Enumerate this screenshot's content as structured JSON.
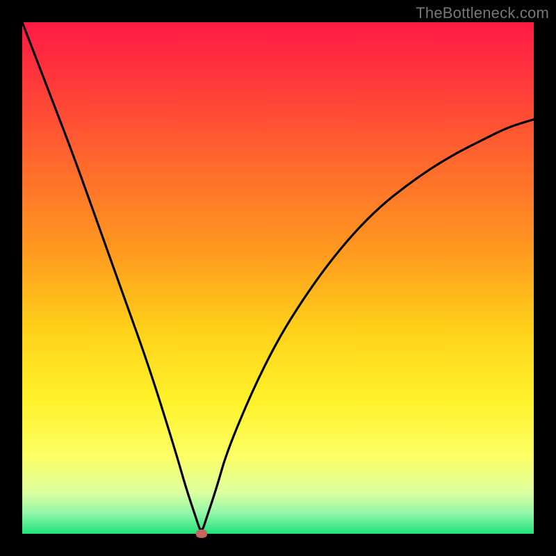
{
  "watermark": {
    "text": "TheBottleneck.com"
  },
  "colors": {
    "page_bg": "#000000",
    "curve": "#000000",
    "marker": "#c66660",
    "gradient_stops": [
      {
        "pct": 0,
        "color": "#ff1a44"
      },
      {
        "pct": 12,
        "color": "#ff3a3a"
      },
      {
        "pct": 28,
        "color": "#ff6a2d"
      },
      {
        "pct": 45,
        "color": "#ff9a1f"
      },
      {
        "pct": 60,
        "color": "#ffd11a"
      },
      {
        "pct": 74,
        "color": "#fff22a"
      },
      {
        "pct": 85,
        "color": "#fcff66"
      },
      {
        "pct": 92,
        "color": "#dcffa0"
      },
      {
        "pct": 96,
        "color": "#90f7a8"
      },
      {
        "pct": 100,
        "color": "#21e27a"
      }
    ]
  },
  "chart_data": {
    "type": "line",
    "title": "",
    "xlabel": "",
    "ylabel": "",
    "xlim": [
      0,
      100
    ],
    "ylim": [
      0,
      100
    ],
    "grid": false,
    "legend": false,
    "series": [
      {
        "name": "bottleneck-curve",
        "x": [
          0,
          5,
          10,
          15,
          20,
          25,
          30,
          32,
          34,
          35,
          36,
          38,
          40,
          45,
          50,
          55,
          60,
          65,
          70,
          75,
          80,
          85,
          90,
          95,
          100
        ],
        "values": [
          100,
          87,
          74,
          60,
          46,
          32,
          16,
          9,
          3,
          0,
          3,
          9,
          16,
          28,
          38,
          46,
          53,
          59,
          64,
          68,
          71.5,
          74.5,
          77,
          79.5,
          81
        ]
      }
    ],
    "marker": {
      "x": 35,
      "y": 0,
      "name": "minimum-point"
    },
    "annotations": []
  }
}
